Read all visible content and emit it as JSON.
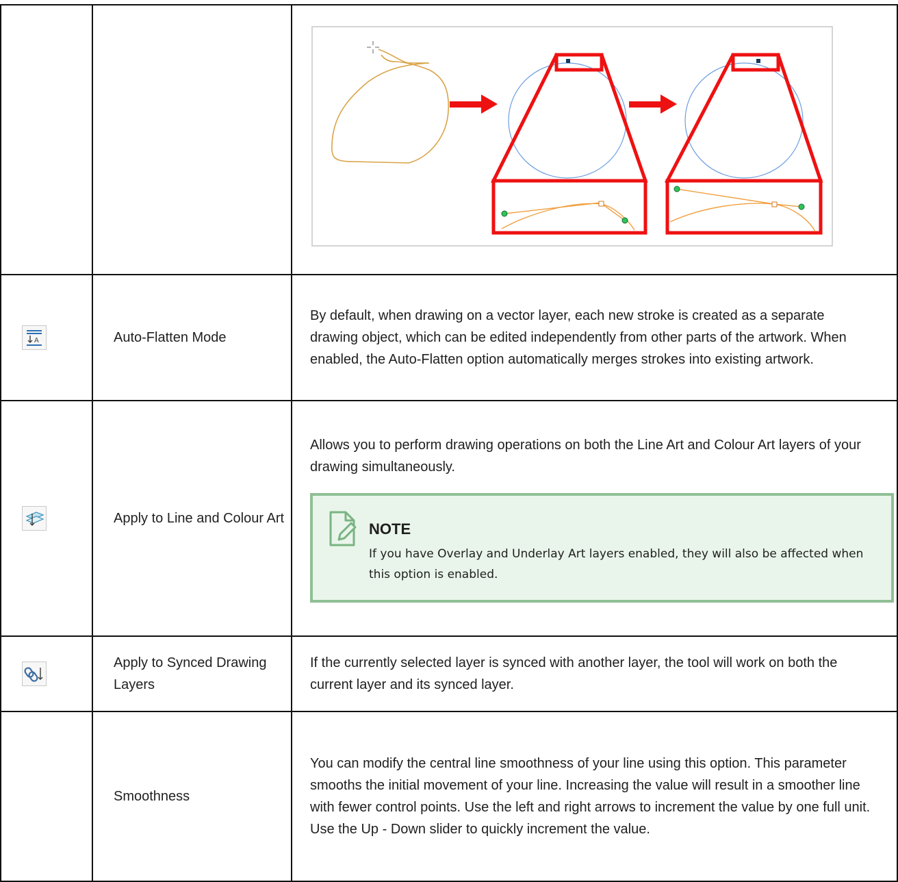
{
  "rows": [
    {
      "name": "",
      "description": ""
    },
    {
      "name": "Auto-Flatten Mode",
      "icon": "auto-flatten-icon",
      "description": "By default, when drawing on a vector layer, each new stroke is created as a separate drawing object, which can be edited independently from other parts of the artwork. When enabled, the Auto-Flatten option automatically merges strokes into existing artwork."
    },
    {
      "name": "Apply to Line and Colour Art",
      "icon": "apply-line-colour-art-icon",
      "description": "Allows you to perform drawing operations on both the Line Art and Colour Art layers of your drawing simultaneously.",
      "note": {
        "title": "NOTE",
        "text": "If you have Overlay and Underlay Art layers enabled, they will also be affected when this option is enabled."
      }
    },
    {
      "name": "Apply to Synced Drawing Layers",
      "icon": "synced-layers-icon",
      "description": "If the currently selected layer is synced with another layer, the tool will work on both the current layer and its synced layer."
    },
    {
      "name": "Smoothness",
      "description": "You can modify the central line smoothness of your line using this option. This parameter smooths the initial movement of your line. Increasing the value will result in a smoother line with fewer control points. Use the left and right arrows to increment the value by one full unit. Use the Up - Down slider to quickly increment the value."
    }
  ],
  "colors": {
    "border": "#111111",
    "note_border": "#8fbf95",
    "note_background": "#e9f5ea",
    "arrow": "#ee1111",
    "stroke_orange": "#d9a347",
    "curve_blue": "#6a9de0"
  }
}
